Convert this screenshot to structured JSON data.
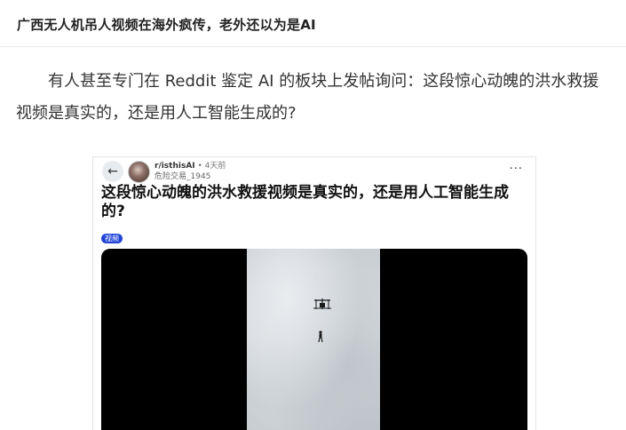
{
  "article": {
    "title": "广西无人机吊人视频在海外疯传，老外还以为是AI",
    "paragraph": "有人甚至专门在 Reddit 鉴定 AI 的板块上发帖询问：这段惊心动魄的洪水救援视频是真实的，还是用人工智能生成的?"
  },
  "post": {
    "back_icon": "arrow-left-icon",
    "subreddit": "r/isthisAI",
    "separator": " • ",
    "age": "4天前",
    "username": "危险交易_1945",
    "more_icon": "ellipsis-icon",
    "more_label": "···",
    "title": "这段惊心动魄的洪水救援视频是真实的，还是用人工智能生成的?",
    "flair": "视频"
  },
  "colors": {
    "flair_bg": "#2144d6",
    "video_bg": "#000000"
  }
}
